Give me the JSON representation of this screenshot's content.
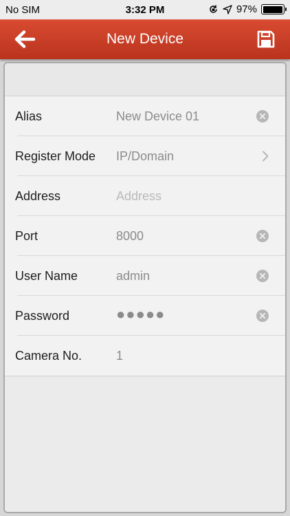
{
  "status_bar": {
    "carrier": "No SIM",
    "time": "3:32 PM",
    "battery": "97%"
  },
  "nav": {
    "title": "New Device",
    "back_icon": "arrow-left-icon",
    "save_icon": "floppy-disk-icon",
    "accent_color": "#c73c25"
  },
  "form": {
    "rows": [
      {
        "label": "Alias",
        "value": "New Device 01"
      },
      {
        "label": "Register Mode",
        "value": "IP/Domain"
      },
      {
        "label": "Address",
        "placeholder": "Address"
      },
      {
        "label": "Port",
        "value": "8000"
      },
      {
        "label": "User Name",
        "value": "admin"
      },
      {
        "label": "Password",
        "value": "●●●●●"
      },
      {
        "label": "Camera No.",
        "value": "1"
      }
    ]
  }
}
